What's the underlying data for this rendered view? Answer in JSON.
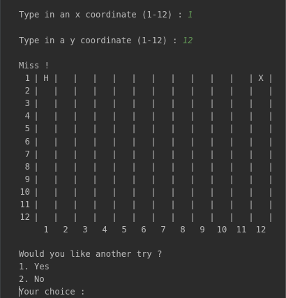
{
  "prompts": {
    "x_label": "Type in an x coordinate (1-12) : ",
    "x_value": "1",
    "y_label": "Type in a y coordinate (1-12) : ",
    "y_value": "12"
  },
  "result": "Miss !",
  "grid": {
    "rows": [
      "1",
      "2",
      "3",
      "4",
      "5",
      "6",
      "7",
      "8",
      "9",
      "10",
      "11",
      "12"
    ],
    "cols": [
      "1",
      "2",
      "3",
      "4",
      "5",
      "6",
      "7",
      "8",
      "9",
      "10",
      "11",
      "12"
    ],
    "marks": [
      {
        "row": 0,
        "col": 0,
        "text": "H"
      },
      {
        "row": 0,
        "col": 11,
        "text": "X"
      }
    ]
  },
  "menu": {
    "question": "Would you like another try ?",
    "option1": "1. Yes",
    "option2": "2. No",
    "choice_prompt": "Your choice :"
  },
  "colors": {
    "background": "#2b2b2b",
    "text": "#bbbbbb",
    "input": "#629755"
  }
}
